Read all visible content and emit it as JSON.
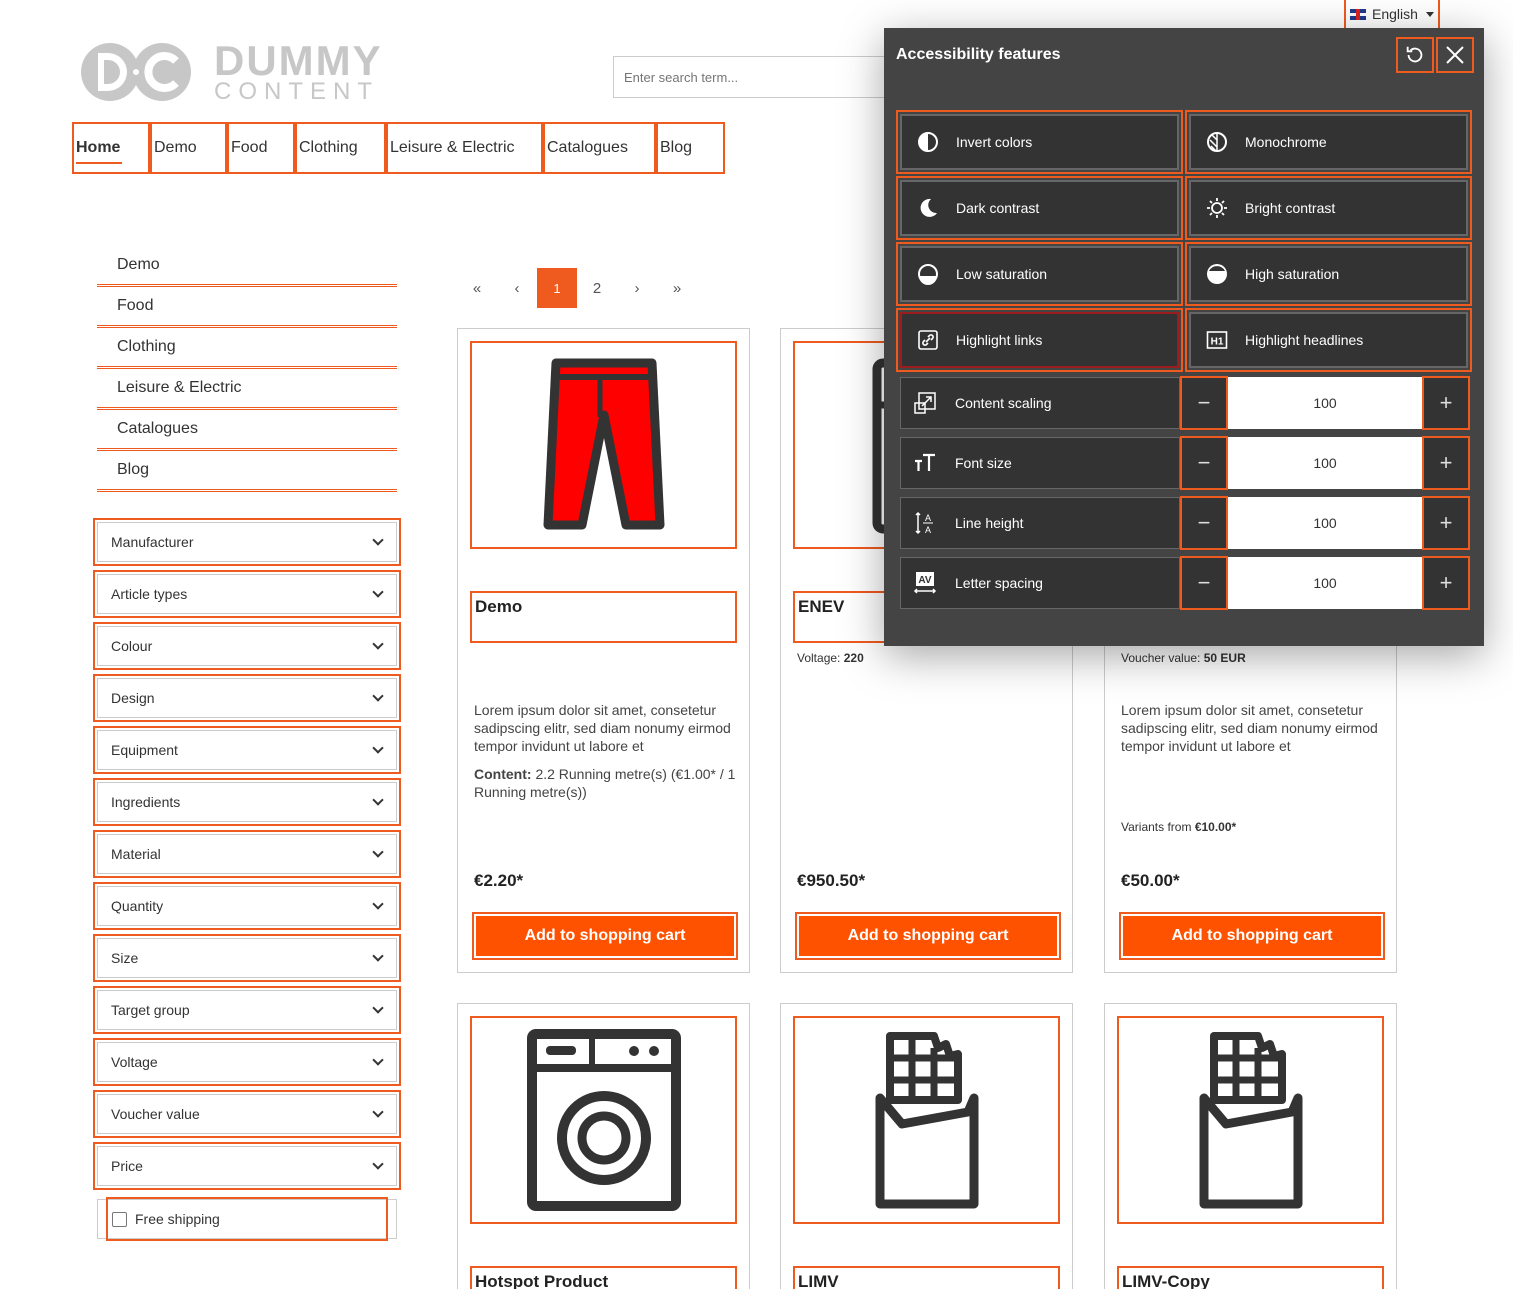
{
  "language": {
    "label": "English"
  },
  "logo": {
    "mark": "D·C",
    "line1": "DUMMY",
    "line2": "CONTENT"
  },
  "search": {
    "placeholder": "Enter search term..."
  },
  "main_nav": [
    "Home",
    "Demo",
    "Food",
    "Clothing",
    "Leisure & Electric",
    "Catalogues",
    "Blog"
  ],
  "sidebar_categories": [
    "Demo",
    "Food",
    "Clothing",
    "Leisure & Electric",
    "Catalogues",
    "Blog"
  ],
  "filters": [
    "Manufacturer",
    "Article types",
    "Colour",
    "Design",
    "Equipment",
    "Ingredients",
    "Material",
    "Quantity",
    "Size",
    "Target group",
    "Voltage",
    "Voucher value",
    "Price"
  ],
  "free_shipping": "Free shipping",
  "pagination": {
    "first": "«",
    "prev": "‹",
    "pages": [
      "1",
      "2"
    ],
    "current": "1",
    "next": "›",
    "last": "»"
  },
  "products": [
    {
      "name": "Demo",
      "description": "Lorem ipsum dolor sit amet, consetetur sadipscing elitr, sed diam nonumy eirmod tempor invidunt ut labore et",
      "content_label": "Content:",
      "content_value": "2.2 Running metre(s) (€1.00* / 1 Running metre(s))",
      "price": "€2.20*",
      "button": "Add to shopping cart",
      "icon": "trousers-icon"
    },
    {
      "name": "ENEV",
      "prop_label": "Voltage:",
      "prop_value": "220",
      "price": "€950.50*",
      "button": "Add to shopping cart",
      "icon": "fridge-icon"
    },
    {
      "prop_label": "Voucher value:",
      "prop_value": "50 EUR",
      "description": "Lorem ipsum dolor sit amet, consetetur sadipscing elitr, sed diam nonumy eirmod tempor invidunt ut labore et",
      "variants_label": "Variants from",
      "variants_value": "€10.00*",
      "price": "€50.00*",
      "button": "Add to shopping cart",
      "icon": "voucher-icon"
    },
    {
      "name": "Hotspot Product",
      "icon": "washing-machine-icon"
    },
    {
      "name": "LIMV",
      "icon": "chocolate-icon"
    },
    {
      "name": "LIMV-Copy",
      "icon": "chocolate-icon"
    }
  ],
  "accessibility": {
    "title": "Accessibility features",
    "features": [
      {
        "label": "Invert colors",
        "icon": "invert-icon"
      },
      {
        "label": "Monochrome",
        "icon": "monochrome-icon"
      },
      {
        "label": "Dark contrast",
        "icon": "moon-icon"
      },
      {
        "label": "Bright contrast",
        "icon": "sun-icon"
      },
      {
        "label": "Low saturation",
        "icon": "low-saturation-icon"
      },
      {
        "label": "High saturation",
        "icon": "high-saturation-icon"
      },
      {
        "label": "Highlight links",
        "icon": "link-icon"
      },
      {
        "label": "Highlight headlines",
        "icon": "h1-icon"
      }
    ],
    "scalers": [
      {
        "label": "Content scaling",
        "value": "100",
        "icon": "scale-icon"
      },
      {
        "label": "Font size",
        "value": "100",
        "icon": "font-size-icon"
      },
      {
        "label": "Line height",
        "value": "100",
        "icon": "line-height-icon"
      },
      {
        "label": "Letter spacing",
        "value": "100",
        "icon": "letter-spacing-icon"
      }
    ]
  },
  "colors": {
    "accent": "#ef5a1f",
    "button": "#ff5200",
    "panel": "#444444",
    "panel_button": "#333333"
  }
}
